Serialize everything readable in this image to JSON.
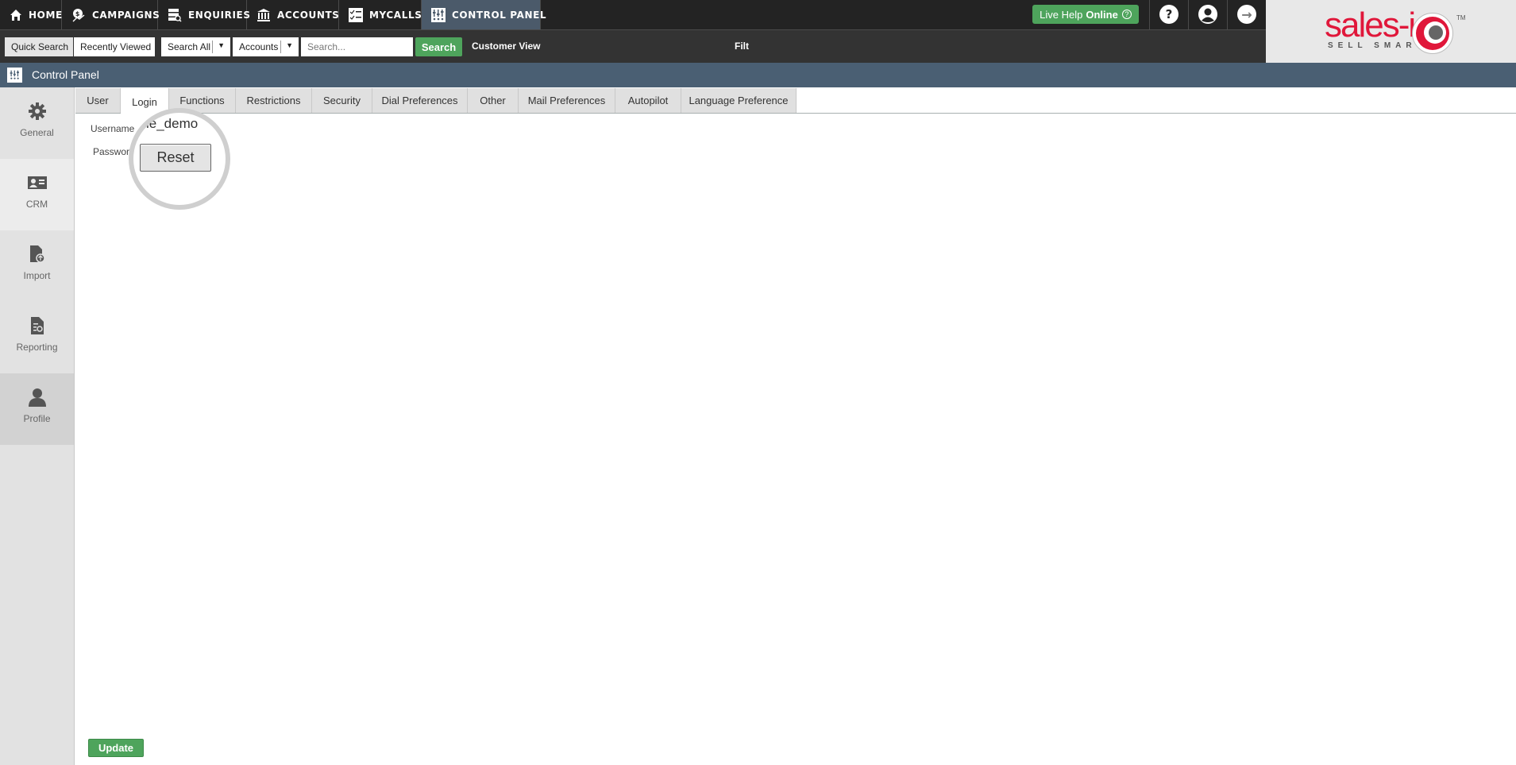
{
  "topnav": {
    "items": [
      {
        "label": "HOME",
        "icon": "home-icon"
      },
      {
        "label": "CAMPAIGNS",
        "icon": "campaigns-icon"
      },
      {
        "label": "ENQUIRIES",
        "icon": "enquiries-icon"
      },
      {
        "label": "ACCOUNTS",
        "icon": "accounts-icon"
      },
      {
        "label": "MYCALLS",
        "icon": "mycalls-icon"
      },
      {
        "label": "CONTROL PANEL",
        "icon": "control-panel-icon",
        "active": true
      }
    ],
    "live_help": {
      "prefix": "Live Help",
      "status": "Online"
    },
    "help_glyph": "?",
    "logout_glyph": "→"
  },
  "logo": {
    "text": "sales-i",
    "tagline": "SELL SMART",
    "tm": "TM"
  },
  "subbar": {
    "quick_search": "Quick Search",
    "recently_viewed": "Recently Viewed",
    "scope_select": "Search All",
    "entity_select": "Accounts",
    "search_placeholder": "Search...",
    "search_button": "Search",
    "customer_view": "Customer View",
    "filter_partial": "Filt"
  },
  "titlebar": {
    "title": "Control Panel"
  },
  "sidebar": {
    "items": [
      {
        "label": "General"
      },
      {
        "label": "CRM"
      },
      {
        "label": "Import"
      },
      {
        "label": "Reporting"
      },
      {
        "label": "Profile",
        "active": true
      }
    ]
  },
  "tabs": [
    {
      "label": "User"
    },
    {
      "label": "Login",
      "active": true
    },
    {
      "label": "Functions"
    },
    {
      "label": "Restrictions"
    },
    {
      "label": "Security"
    },
    {
      "label": "Dial Preferences"
    },
    {
      "label": "Other"
    },
    {
      "label": "Mail Preferences"
    },
    {
      "label": "Autopilot"
    },
    {
      "label": "Language Preference"
    }
  ],
  "form": {
    "username_label": "Username",
    "username_value_visible": "le_demo",
    "password_label": "Password",
    "reset_button": "Reset",
    "update_button": "Update"
  },
  "colors": {
    "nav_bg": "#232323",
    "nav_active": "#4b5a6a",
    "titlebar": "#4a5f73",
    "green": "#4ea45c",
    "brand_red": "#e0173a"
  }
}
